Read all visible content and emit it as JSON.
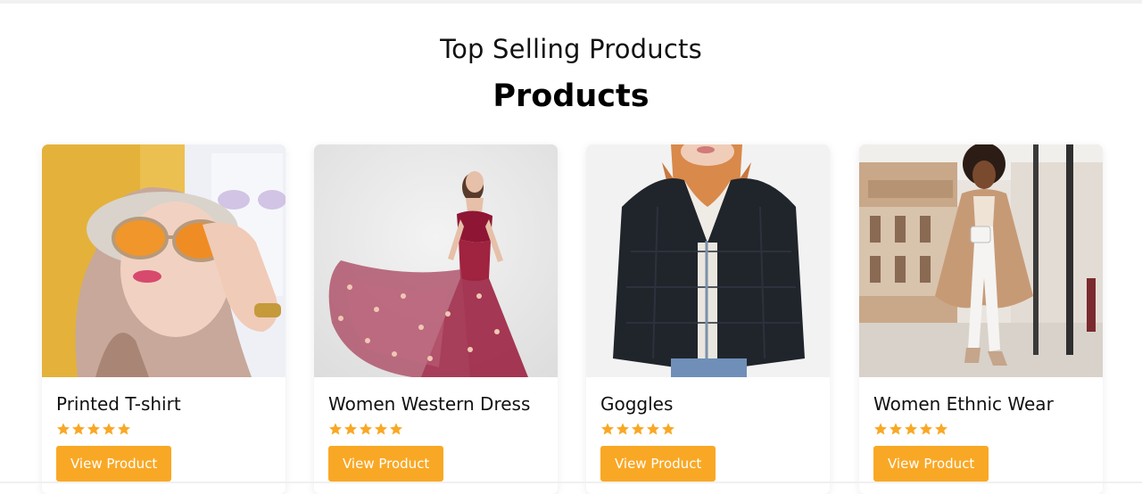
{
  "section": {
    "eyebrow": "Top Selling Products",
    "heading": "Products"
  },
  "theme": {
    "accent": "#f9a825",
    "star_color": "#f9a825",
    "button_text_color": "#ffffff"
  },
  "products": [
    {
      "title": "Printed T-shirt",
      "rating": 5,
      "max_rating": 5,
      "button_label": "View Product",
      "image_icon": "woman-sunglasses-photo"
    },
    {
      "title": "Women Western Dress",
      "rating": 5,
      "max_rating": 5,
      "button_label": "View Product",
      "image_icon": "red-gown-photo"
    },
    {
      "title": "Goggles",
      "rating": 5,
      "max_rating": 5,
      "button_label": "View Product",
      "image_icon": "fur-jacket-photo"
    },
    {
      "title": "Women Ethnic Wear",
      "rating": 5,
      "max_rating": 5,
      "button_label": "View Product",
      "image_icon": "street-coat-photo"
    }
  ]
}
